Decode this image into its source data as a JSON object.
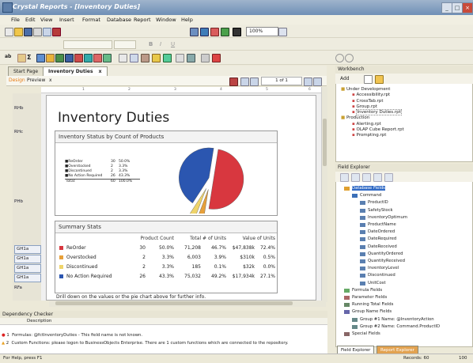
{
  "window": {
    "title": "Crystal Reports - [Inventory Duties]"
  },
  "menu": [
    "File",
    "Edit",
    "View",
    "Insert",
    "Format",
    "Database",
    "Report",
    "Window",
    "Help"
  ],
  "toolbar": {
    "zoom": "100%"
  },
  "tabs": {
    "start_page": "Start Page",
    "doc_tab": "Inventory Duties",
    "close": "x"
  },
  "subtabs": {
    "design": "Design",
    "preview": "Preview",
    "close": "x",
    "page_indicator": "1 of 1"
  },
  "ruler": [
    "1",
    "2",
    "3",
    "4",
    "5",
    "6"
  ],
  "sections": [
    "RHb",
    "RHc",
    "PHb",
    "GH1a",
    "GH1a",
    "GH1a",
    "GH1a",
    "RFa"
  ],
  "report": {
    "title": "Inventory Duties",
    "status_box": {
      "title": "Inventory Status by Count of Products",
      "legend": [
        {
          "label": "ReOrder",
          "count": "30",
          "pct": "50.0%"
        },
        {
          "label": "Overstocked",
          "count": "2",
          "pct": "3.3%"
        },
        {
          "label": "Discontinued",
          "count": "2",
          "pct": "3.3%"
        },
        {
          "label": "No Action Required",
          "count": "26",
          "pct": "43.3%"
        },
        {
          "label": "Total:",
          "count": "60",
          "pct": "100.0%"
        }
      ]
    },
    "summary": {
      "title": "Summary Stats",
      "headers": [
        "Product Count",
        "Total # of Units",
        "Value of Units"
      ],
      "rows": [
        {
          "label": "ReOrder",
          "count": "30",
          "count_pct": "50.0%",
          "units": "71,208",
          "units_pct": "46.7%",
          "value": "$47,838k",
          "value_pct": "72.4%"
        },
        {
          "label": "Overstocked",
          "count": "2",
          "count_pct": "3.3%",
          "units": "6,003",
          "units_pct": "3.9%",
          "value": "$310k",
          "value_pct": "0.5%"
        },
        {
          "label": "Discontinued",
          "count": "2",
          "count_pct": "3.3%",
          "units": "185",
          "units_pct": "0.1%",
          "value": "$32k",
          "value_pct": "0.0%"
        },
        {
          "label": "No Action Required",
          "count": "26",
          "count_pct": "43.3%",
          "units": "75,032",
          "units_pct": "49.2%",
          "value": "$17,934k",
          "value_pct": "27.1%"
        }
      ],
      "footnote": "Drill down on the values or the pie chart above for further info."
    }
  },
  "workbench": {
    "title": "Workbench",
    "add": "Add",
    "items": [
      "Under Development",
      "Accessibility.rpt",
      "CrossTab.rpt",
      "Group.rpt",
      "Inventory Duties.rpt",
      "Production",
      "Alerting.rpt",
      "OLAP Cube Report.rpt",
      "Prompting.rpt"
    ]
  },
  "field_explorer": {
    "title": "Field Explorer",
    "items": [
      "Database Fields",
      "Command",
      "ProductID",
      "SafetyStock",
      "InventoryOptimum",
      "ProductName",
      "DateOrdered",
      "DateRequired",
      "DateReceived",
      "QuantityOrdered",
      "QuantityReceived",
      "InventoryLevel",
      "Discontinued",
      "UnitCost",
      "Formula Fields",
      "Parameter Fields",
      "Running Total Fields",
      "Group Name Fields",
      "Group #1 Name: @InventoryAction",
      "Group #2 Name: Command.ProductID",
      "Special Fields"
    ],
    "bottom_tabs": [
      "Field Explorer",
      "Report Explorer"
    ]
  },
  "dependency": {
    "title": "Dependency Checker",
    "column": "Description",
    "rows": [
      {
        "num": "1",
        "text": "Formulas: @fctInventoryDuties - This field name is not known."
      },
      {
        "num": "2",
        "text": "Custom Functions: please logon to BusinessObjects Enterprise. There are 1 custom functions which are connected to the repository."
      }
    ]
  },
  "status": {
    "left": "For Help, press F1",
    "records": "Records: 60",
    "zoom": "100"
  },
  "chart_data": {
    "type": "pie",
    "title": "Inventory Status by Count of Products",
    "categories": [
      "ReOrder",
      "Overstocked",
      "Discontinued",
      "No Action Required"
    ],
    "values": [
      30,
      2,
      2,
      26
    ],
    "colors": [
      "#d8373f",
      "#e7a03a",
      "#efd46a",
      "#2b56b0"
    ]
  }
}
